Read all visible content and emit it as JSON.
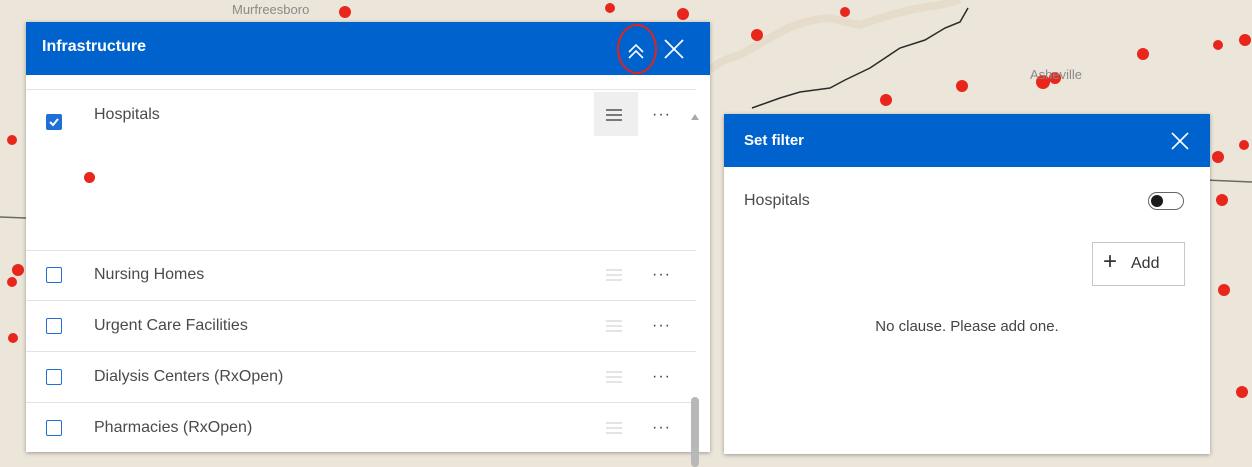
{
  "map": {
    "labels": [
      "Murfreesboro",
      "Asheville"
    ],
    "marker_color": "#e8261c",
    "background": "#ece6da"
  },
  "infrastructure": {
    "title": "Infrastructure",
    "collapse_icon": "double-chevron-up-icon",
    "close_icon": "close-icon",
    "layers": [
      {
        "label": "Hospitals",
        "checked": true,
        "legend": "red-dot-icon"
      },
      {
        "label": "Nursing Homes",
        "checked": false
      },
      {
        "label": "Urgent Care Facilities",
        "checked": false
      },
      {
        "label": "Dialysis Centers (RxOpen)",
        "checked": false
      },
      {
        "label": "Pharmacies (RxOpen)",
        "checked": false
      }
    ],
    "more_label": "···"
  },
  "filter": {
    "title": "Set filter",
    "layer_name": "Hospitals",
    "toggle_on": false,
    "add_label": "Add",
    "add_plus": "+",
    "empty_message": "No clause. Please add one."
  },
  "colors": {
    "header_blue": "#0062cc",
    "checkbox_blue": "#1f6fd6",
    "highlight_ring": "#e2231a"
  }
}
